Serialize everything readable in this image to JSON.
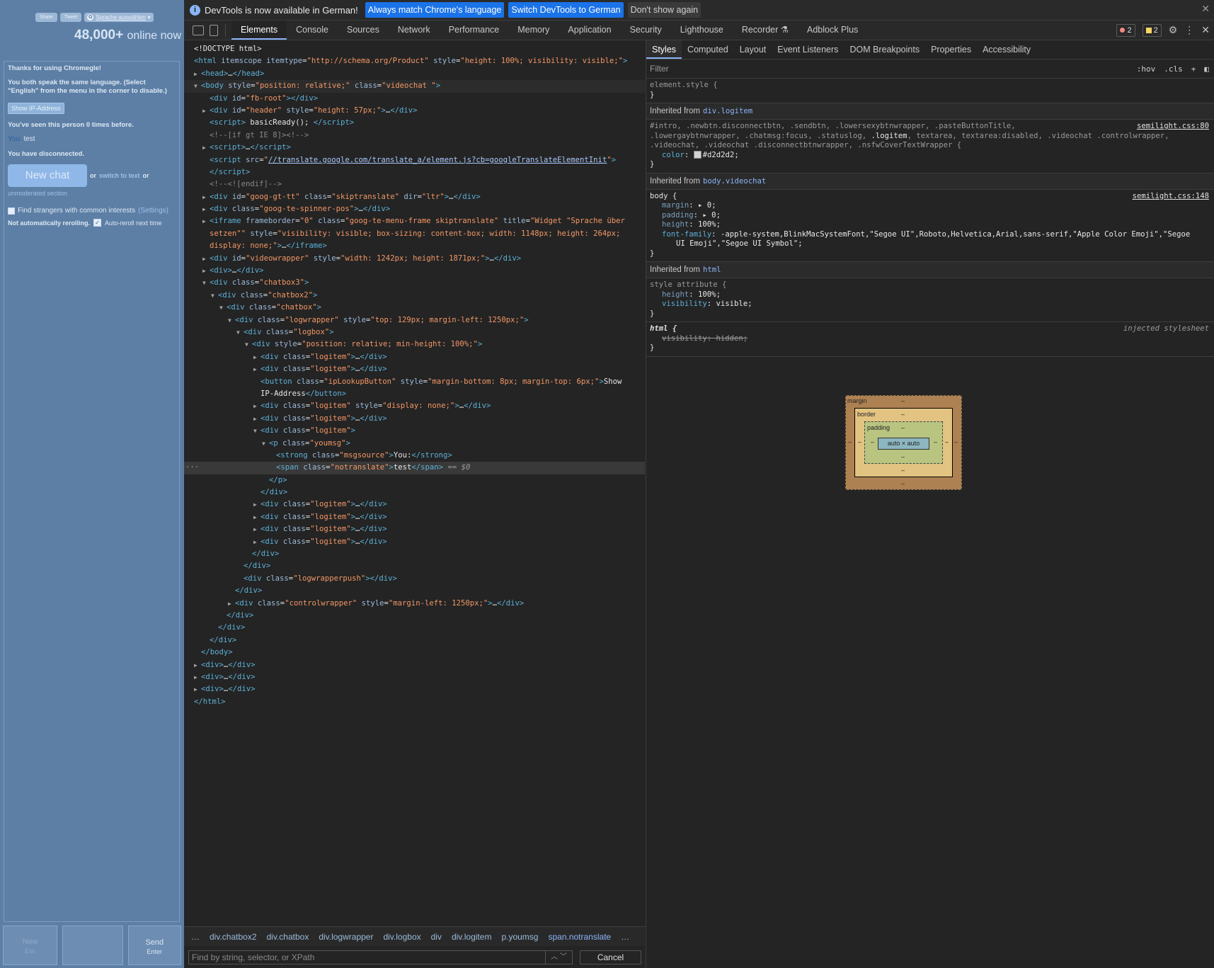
{
  "site": {
    "social": [
      "Share",
      "Tweet"
    ],
    "translate_label": "Sprache auswählen",
    "online_count": "48,000+",
    "online_text": "online now",
    "log": {
      "thanks": "Thanks for using Chromegle!",
      "same_language": "You both speak the same language. (Select \"English\" from the menu in the corner to disable.)",
      "ip_button": "Show IP-Address",
      "seen": "You've seen this person 0 times before.",
      "you_label": "You:",
      "you_msg": "test",
      "disconnected": "You have disconnected.",
      "new_chat": "New chat",
      "or1": "or",
      "switch_text": "switch to text",
      "or2": "or",
      "unmoderated": "unmoderated section",
      "interests": "Find strangers with common interests",
      "settings": "(Settings)",
      "not_rerolling": "Not automatically rerolling.",
      "auto_reroll": "Auto-reroll next time"
    },
    "controls": {
      "new_label": "New",
      "new_key": "Esc",
      "send_label": "Send",
      "send_key": "Enter"
    }
  },
  "devtools": {
    "infobar": {
      "message": "DevTools is now available in German!",
      "btn_match": "Always match Chrome's language",
      "btn_switch": "Switch DevTools to German",
      "btn_dismiss": "Don't show again"
    },
    "tabs": [
      "Elements",
      "Console",
      "Sources",
      "Network",
      "Performance",
      "Memory",
      "Application",
      "Security",
      "Lighthouse",
      "Recorder",
      "Adblock Plus"
    ],
    "active_tab": "Elements",
    "errors": "2",
    "warnings": "2",
    "styles_tabs": [
      "Styles",
      "Computed",
      "Layout",
      "Event Listeners",
      "DOM Breakpoints",
      "Properties",
      "Accessibility"
    ],
    "filter_placeholder": "Filter",
    "filter_hov": ":hov",
    "filter_cls": ".cls",
    "breadcrumbs": [
      "…",
      "div.chatbox2",
      "div.chatbox",
      "div.logwrapper",
      "div.logbox",
      "div",
      "div.logitem",
      "p.youmsg",
      "span.notranslate",
      "…"
    ],
    "search_placeholder": "Find by string, selector, or XPath",
    "cancel": "Cancel",
    "styles": {
      "element_style": "element.style {",
      "inh_logitem_prefix": "Inherited from",
      "inh_logitem": "div.logitem",
      "rule1_selector_a": "#intro, .newbtn.disconnectbtn, .sendbtn, .lowersexybtnwrapper, .pasteButtonTitle,",
      "rule1_selector_b": ".lowergaybtnwrapper, .chatmsg:focus, .statuslog, ",
      "rule1_selector_strong": ".logitem",
      "rule1_selector_c": ", textarea, textarea:disabled, .videochat .controlwrapper,",
      "rule1_selector_d": ".videochat, .videochat .disconnectbtnwrapper, .nsfwCoverTextWrapper {",
      "rule1_src": "semilight.css:80",
      "rule1_prop": "color",
      "rule1_val": "#d2d2d2",
      "inh_body": "body.videochat",
      "rule2_selector": "body {",
      "rule2_src": "semilight.css:148",
      "margin_val": "0",
      "padding_val": "0",
      "height_val": "100%",
      "font_family_val": "-apple-system,BlinkMacSystemFont,\"Segoe UI\",Roboto,Helvetica,Arial,sans-serif,\"Apple Color Emoji\",\"Segoe",
      "font_family_val2": "UI Emoji\",\"Segoe UI Symbol\";",
      "inh_html": "html",
      "rule3_selector": "style attribute {",
      "visibility_val": "visible",
      "rule4_selector": "html {",
      "rule4_src": "injected stylesheet",
      "rule4_prop": "visibility: hidden;"
    },
    "boxmodel": {
      "margin": "margin",
      "border": "border",
      "padding": "padding",
      "content": "auto × auto",
      "dash": "–"
    }
  }
}
